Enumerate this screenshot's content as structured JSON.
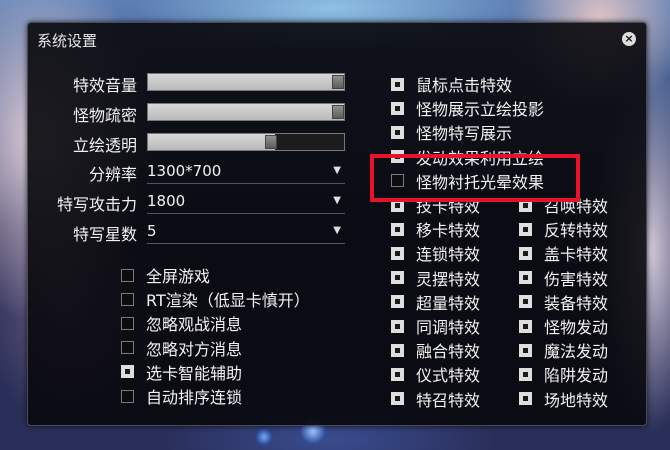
{
  "window": {
    "title": "系统设置",
    "close_label": "×"
  },
  "sliders": [
    {
      "label": "特效音量",
      "level": 1.0
    },
    {
      "label": "怪物疏密",
      "level": 1.0
    },
    {
      "label": "立绘透明",
      "level": 0.65
    }
  ],
  "selects": [
    {
      "label": "分辨率",
      "value": "1300*700"
    },
    {
      "label": "特写攻击力",
      "value": "1800"
    },
    {
      "label": "特写星数",
      "value": "5"
    }
  ],
  "left_checks": [
    {
      "label": "全屏游戏",
      "checked": false
    },
    {
      "label": "RT渲染（低显卡慎开）",
      "checked": false
    },
    {
      "label": "忽略观战消息",
      "checked": false
    },
    {
      "label": "忽略对方消息",
      "checked": false
    },
    {
      "label": "选卡智能辅助",
      "checked": true
    },
    {
      "label": "自动排序连锁",
      "checked": false
    }
  ],
  "right_checks_top": [
    {
      "label": "鼠标点击特效",
      "checked": true
    },
    {
      "label": "怪物展示立绘投影",
      "checked": true
    },
    {
      "label": "怪物特写展示",
      "checked": true
    },
    {
      "label": "发动效果利用立绘",
      "checked": true
    },
    {
      "label": "怪物衬托光晕效果",
      "checked": false
    }
  ],
  "right_grid_col1": [
    {
      "label": "技卡特效",
      "checked": true
    },
    {
      "label": "移卡特效",
      "checked": true
    },
    {
      "label": "连锁特效",
      "checked": true
    },
    {
      "label": "灵摆特效",
      "checked": true
    },
    {
      "label": "超量特效",
      "checked": true
    },
    {
      "label": "同调特效",
      "checked": true
    },
    {
      "label": "融合特效",
      "checked": true
    },
    {
      "label": "仪式特效",
      "checked": true
    },
    {
      "label": "特召特效",
      "checked": true
    }
  ],
  "right_grid_col2": [
    {
      "label": "召唤特效",
      "checked": true
    },
    {
      "label": "反转特效",
      "checked": true
    },
    {
      "label": "盖卡特效",
      "checked": true
    },
    {
      "label": "伤害特效",
      "checked": true
    },
    {
      "label": "装备特效",
      "checked": true
    },
    {
      "label": "怪物发动",
      "checked": true
    },
    {
      "label": "魔法发动",
      "checked": true
    },
    {
      "label": "陷阱发动",
      "checked": true
    },
    {
      "label": "场地特效",
      "checked": true
    }
  ],
  "highlight": {
    "color": "#e8132b"
  }
}
